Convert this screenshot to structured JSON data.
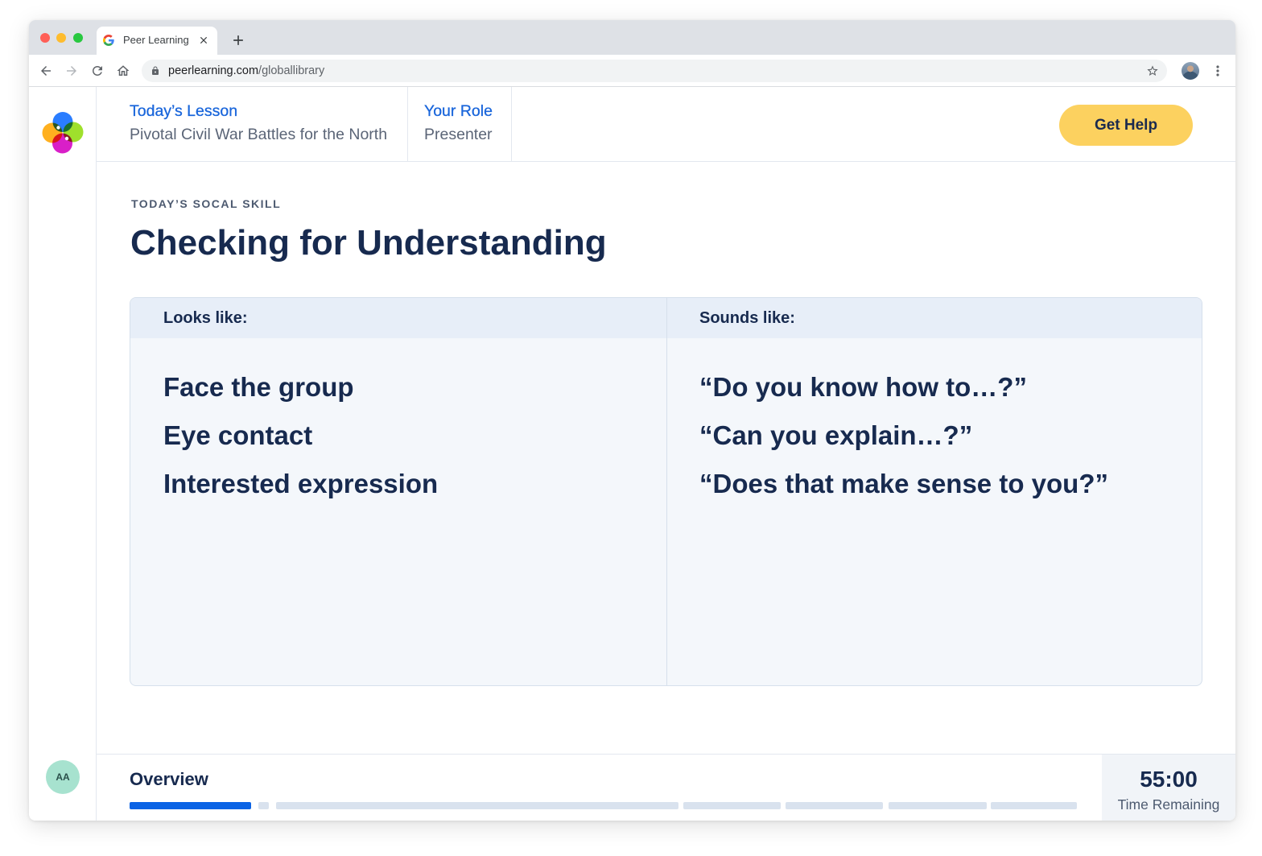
{
  "browser": {
    "tab": {
      "title": "Peer Learning",
      "favicon": "google-g-icon"
    },
    "url": {
      "domain": "peerlearning.com",
      "path": "/globallibrary"
    },
    "icons": [
      "back-arrow-icon",
      "forward-arrow-icon",
      "reload-icon",
      "home-icon",
      "lock-icon",
      "star-icon",
      "kebab-menu-icon",
      "close-icon",
      "plus-icon"
    ]
  },
  "sidebar": {
    "logo": "app-logo-icon",
    "user_initials": "AA"
  },
  "header": {
    "lesson": {
      "label": "Today’s Lesson",
      "value": "Pivotal Civil War Battles for the North"
    },
    "role": {
      "label": "Your Role",
      "value": "Presenter"
    },
    "help_button": "Get Help"
  },
  "skill": {
    "eyebrow": "TODAY’S SOCAL SKILL",
    "title": "Checking for Understanding",
    "columns": [
      {
        "heading": "Looks like:",
        "items": [
          "Face the group",
          "Eye contact",
          "Interested expression"
        ]
      },
      {
        "heading": "Sounds like:",
        "items": [
          "“Do you know how to…?”",
          "“Can you explain…?”",
          "“Does that make sense to you?”"
        ]
      }
    ]
  },
  "footer": {
    "section": "Overview",
    "progress_segments_filled": [
      1,
      0,
      0,
      0,
      0,
      0,
      0
    ],
    "timer": {
      "value": "55:00",
      "label": "Time Remaining"
    }
  },
  "colors": {
    "accent": "#1a66db",
    "button": "#fcd15f",
    "text": "#172a4f",
    "progress_fill": "#0b63e5",
    "progress_track": "#d9e2ee",
    "avatar": "#a7e2cf"
  }
}
